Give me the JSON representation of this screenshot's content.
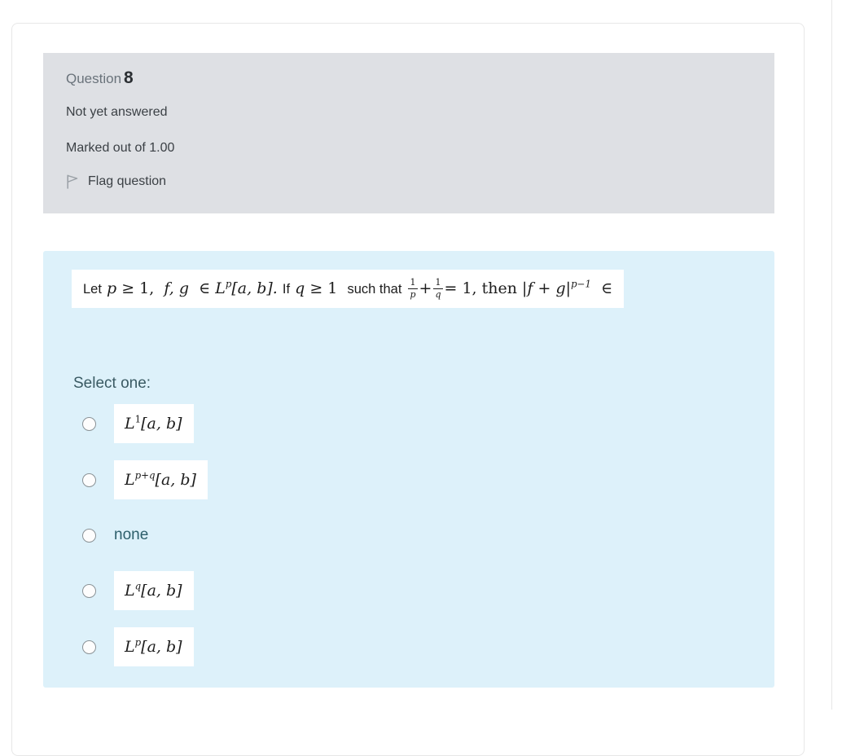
{
  "card": {
    "info": {
      "question_word": "Question",
      "question_number": "8",
      "state": "Not yet answered",
      "marks": "Marked out of 1.00",
      "flag_label": "Flag question",
      "flag_icon": "flag-icon",
      "background_color": "#dee0e4"
    },
    "answer_panel": {
      "background_color": "#ddf1fa",
      "statement": {
        "lead": "Let",
        "var_p": "p",
        "rel1": "≥ 1,",
        "fns": "f, g",
        "in1": "∈",
        "space_lp": "L",
        "space_lp_sup": "p",
        "interval1": "[a, b].",
        "if_word": "If",
        "var_q": "q",
        "rel2": "≥ 1",
        "suchthat": "such that",
        "frac1_num": "1",
        "frac1_den": "p",
        "plus": "+",
        "frac2_num": "1",
        "frac2_den": "q",
        "equals": "= 1, then",
        "abs_open": "|",
        "abs_f": "f",
        "abs_plus": "+",
        "abs_g": "g",
        "abs_close": "|",
        "abs_sup": "p−1",
        "in2": "∈",
        "plain_text": "Let p ≥ 1,  f, g ∈ Lᵖ[a, b]. If q ≥ 1  such that 1/p + 1/q = 1, then |f + g|ᵖ⁻¹ ∈"
      },
      "select_one_label": "Select one:",
      "options": [
        {
          "id": "option-l1",
          "base": "L",
          "sup": "1",
          "interval": "[a, b]",
          "boxed": true,
          "plain": "L¹[a, b]"
        },
        {
          "id": "option-lpq",
          "base": "L",
          "sup": "p+q",
          "interval": "[a, b]",
          "boxed": true,
          "plain": "Lᵖ⁺ᶠ[a, b]"
        },
        {
          "id": "option-none",
          "base": "",
          "sup": "",
          "interval": "",
          "boxed": false,
          "plain": "none",
          "text": "none"
        },
        {
          "id": "option-lq",
          "base": "L",
          "sup": "q",
          "interval": "[a, b]",
          "boxed": true,
          "plain": "Lˠ[a, b]"
        },
        {
          "id": "option-lp",
          "base": "L",
          "sup": "p",
          "interval": "[a, b]",
          "boxed": true,
          "plain": "Lᵖ[a, b]"
        }
      ]
    }
  }
}
